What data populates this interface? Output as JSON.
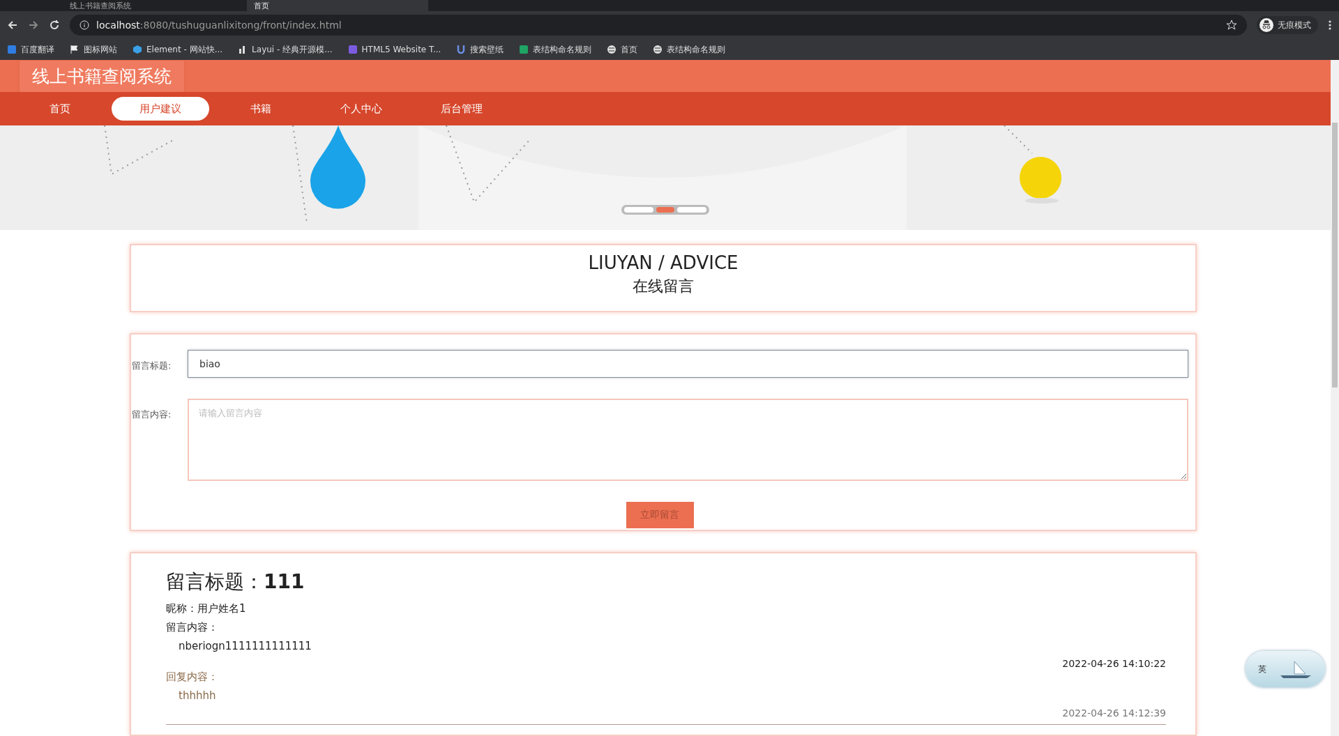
{
  "browser": {
    "tabs": [
      {
        "title": "线上书籍查阅系统",
        "selected": false
      },
      {
        "title": "首页",
        "selected": true
      }
    ],
    "address": {
      "host": "localhost",
      "path": ":8080/tushuguanlixitong/front/index.html"
    },
    "profile": "无痕模式",
    "bookmarks": [
      "百度翻译",
      "图标网站",
      "Element - 网站快...",
      "Layui - 经典开源模...",
      "HTML5 Website T...",
      "搜索壁纸",
      "表结构命名规则",
      "首页",
      "表结构命名规则"
    ]
  },
  "site": {
    "title": "线上书籍查阅系统",
    "nav": [
      {
        "label": "首页",
        "selected": false
      },
      {
        "label": "用户建议",
        "selected": true
      },
      {
        "label": "书籍",
        "selected": false
      },
      {
        "label": "个人中心",
        "selected": false
      },
      {
        "label": "后台管理",
        "selected": false
      }
    ]
  },
  "banner": {
    "kind": "picture",
    "slides": [
      {
        "selected": false
      },
      {
        "selected": true
      },
      {
        "selected": false
      }
    ]
  },
  "heading": {
    "title": "LIUYAN / ADVICE",
    "subtitle": "在线留言"
  },
  "form": {
    "fields": [
      {
        "kind": "input",
        "label": "留言标题:",
        "value": "biao"
      },
      {
        "kind": "textarea",
        "label": "留言内容:",
        "placeholder": "请输入留言内容"
      }
    ],
    "submit": "立即留言"
  },
  "messages": [
    {
      "title_label": "留言标题：",
      "title": "111",
      "nickname": "昵称：用户姓名1",
      "content_label": "留言内容：",
      "content": "nberiogn1111111111111",
      "time": "2022-04-26 14:10:22",
      "reply_label": "回复内容：",
      "reply": "thhhhh",
      "reply_time": "2022-04-26 14:12:39"
    }
  ],
  "ime": {
    "label": "英"
  }
}
